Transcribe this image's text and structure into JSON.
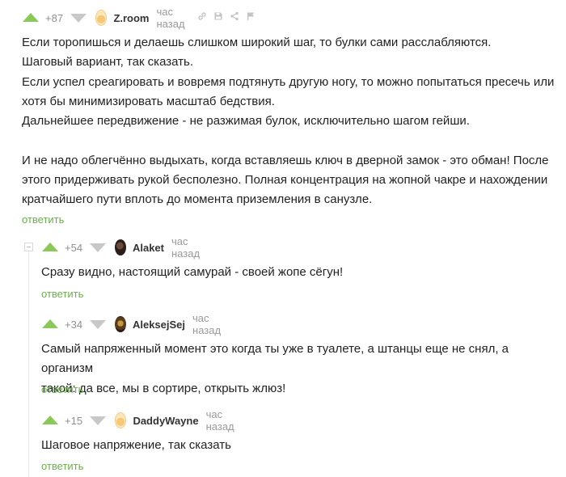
{
  "comments": [
    {
      "rating": "+87",
      "author": "Z.room",
      "time": "час назад",
      "lines": [
        "Если торопишься и делаешь слишком широкий шаг, то булки сами расслабляются.",
        "Шаговый вариант, так сказать.",
        "Если успел среагировать и вовремя подтянуть другую ногу, то можно попытаться пресечь или",
        "хотя бы минимизировать масштаб бедствия.",
        "Дальнейшее передвижение - не разжимая булок, исключительно шагом гейши.",
        "",
        "И не надо облегчённо выдыхать, когда вставляешь ключ в дверной замок - это обман! После",
        "этого придерживать рукой бесполезно. Полная концентрация на жопной чакре и нахождении",
        "кратчайшего пути вплоть до момента приземления в санузле."
      ],
      "reply_label": "ответить"
    },
    {
      "rating": "+54",
      "author": "Alaket",
      "time": "час назад",
      "lines": [
        "Сразу видно, настоящий самурай - своей жопе сёгун!"
      ],
      "reply_label": "ответить"
    },
    {
      "rating": "+34",
      "author": "AleksejSej",
      "time": "час назад",
      "lines": [
        "Самый напряженный момент это когда ты уже в туалете, а штанцы еще не снял, а организм",
        "такой: да все, мы в сортире, открыть жлюз!"
      ],
      "reply_label": "ответить"
    },
    {
      "rating": "+15",
      "author": "DaddyWayne",
      "time": "час назад",
      "lines": [
        "Шаговое напряжение, так сказать"
      ],
      "reply_label": "ответить"
    }
  ],
  "icons": {
    "vote_up_color": "#8ac858",
    "vote_down_color": "#c8c8c8",
    "reply_color": "#6ab04c",
    "tools": [
      "link-icon",
      "save-icon",
      "share-icon",
      "flag-icon"
    ]
  }
}
